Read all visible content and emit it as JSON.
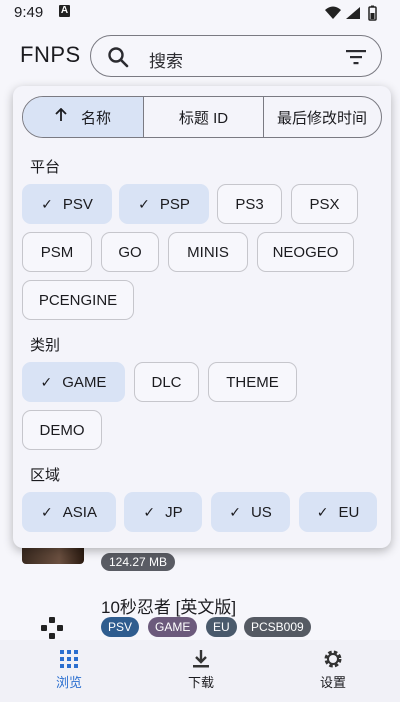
{
  "status": {
    "time": "9:49",
    "notif_letter": "A"
  },
  "app": {
    "title": "FNPS"
  },
  "search": {
    "placeholder": "搜索"
  },
  "sort": {
    "options": [
      {
        "label": "名称",
        "active": true
      },
      {
        "label": "标题 ID",
        "active": false
      },
      {
        "label": "最后修改时间",
        "active": false
      }
    ]
  },
  "platform": {
    "label": "平台",
    "chips": [
      {
        "label": "PSV",
        "selected": true
      },
      {
        "label": "PSP",
        "selected": true
      },
      {
        "label": "PS3",
        "selected": false
      },
      {
        "label": "PSX",
        "selected": false
      },
      {
        "label": "PSM",
        "selected": false
      },
      {
        "label": "GO",
        "selected": false
      },
      {
        "label": "MINIS",
        "selected": false
      },
      {
        "label": "NEOGEO",
        "selected": false
      },
      {
        "label": "PCENGINE",
        "selected": false
      }
    ]
  },
  "category": {
    "label": "类别",
    "chips": [
      {
        "label": "GAME",
        "selected": true
      },
      {
        "label": "DLC",
        "selected": false
      },
      {
        "label": "THEME",
        "selected": false
      },
      {
        "label": "DEMO",
        "selected": false
      }
    ]
  },
  "region": {
    "label": "区域",
    "chips": [
      {
        "label": "ASIA",
        "selected": true
      },
      {
        "label": "JP",
        "selected": true
      },
      {
        "label": "US",
        "selected": true
      },
      {
        "label": "EU",
        "selected": true
      }
    ]
  },
  "list": {
    "size": "124.27 MB",
    "title": "10秒忍者 [英文版]",
    "tags": [
      "PSV",
      "GAME",
      "EU",
      "PCSB009"
    ]
  },
  "colors": {
    "accent": "#2b6fd0",
    "selected_chip": "#d9e3f5",
    "tag_psv": "#2f5d8f",
    "tag_game": "#6c5a7c",
    "tag_eu": "#4a5a6c",
    "tag_id": "#555a63"
  },
  "nav": {
    "items": [
      {
        "label": "浏览",
        "icon": "grid-icon",
        "active": true
      },
      {
        "label": "下载",
        "icon": "download-icon",
        "active": false
      },
      {
        "label": "设置",
        "icon": "gear-icon",
        "active": false
      }
    ]
  }
}
